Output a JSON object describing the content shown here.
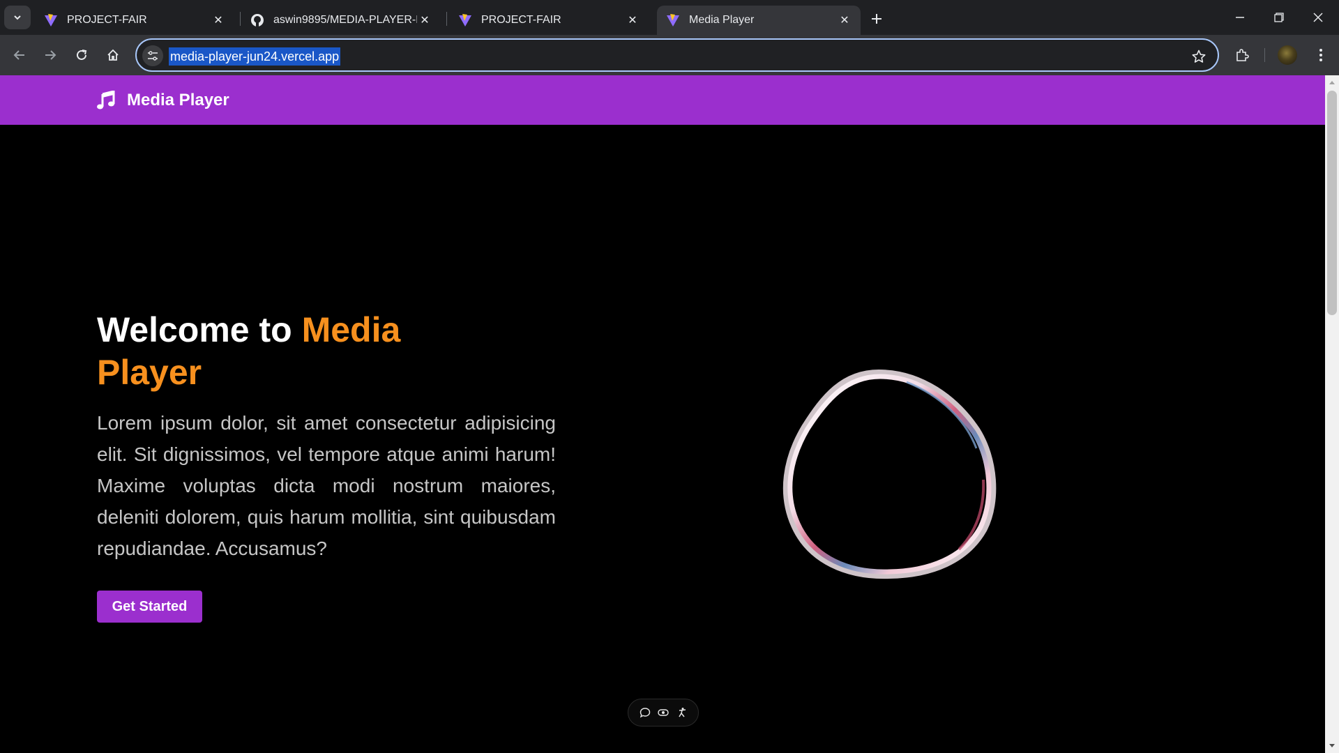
{
  "browser": {
    "tabs": [
      {
        "title": "PROJECT-FAIR",
        "favicon": "vite-logo-icon",
        "active": false
      },
      {
        "title": "aswin9895/MEDIA-PLAYER-FRO",
        "favicon": "github-icon",
        "active": false
      },
      {
        "title": "PROJECT-FAIR",
        "favicon": "vite-logo-icon",
        "active": false
      },
      {
        "title": "Media Player",
        "favicon": "vite-logo-icon",
        "active": true
      }
    ],
    "url": "media-player-jun24.vercel.app"
  },
  "navbar": {
    "brand": "Media Player",
    "brand_icon": "music-note-icon",
    "color": "#9b2fce"
  },
  "hero": {
    "title_white": "Welcome to ",
    "title_accent_1": "Media",
    "title_accent_2": "Player",
    "accent_color": "#f7901e",
    "paragraph": "Lorem ipsum dolor, sit amet consectetur adipisicing elit. Sit dignissimos, vel tempore atque animi harum! Maxime voluptas dicta modi nostrum maiores, deleniti dolorem, quis harum mollitia, sint quibusdam repudiandae. Accusamus?",
    "cta_label": "Get Started"
  },
  "widget": {
    "icons": [
      "chat-bubble-icon",
      "eye-toggle-icon",
      "accessibility-icon"
    ]
  }
}
